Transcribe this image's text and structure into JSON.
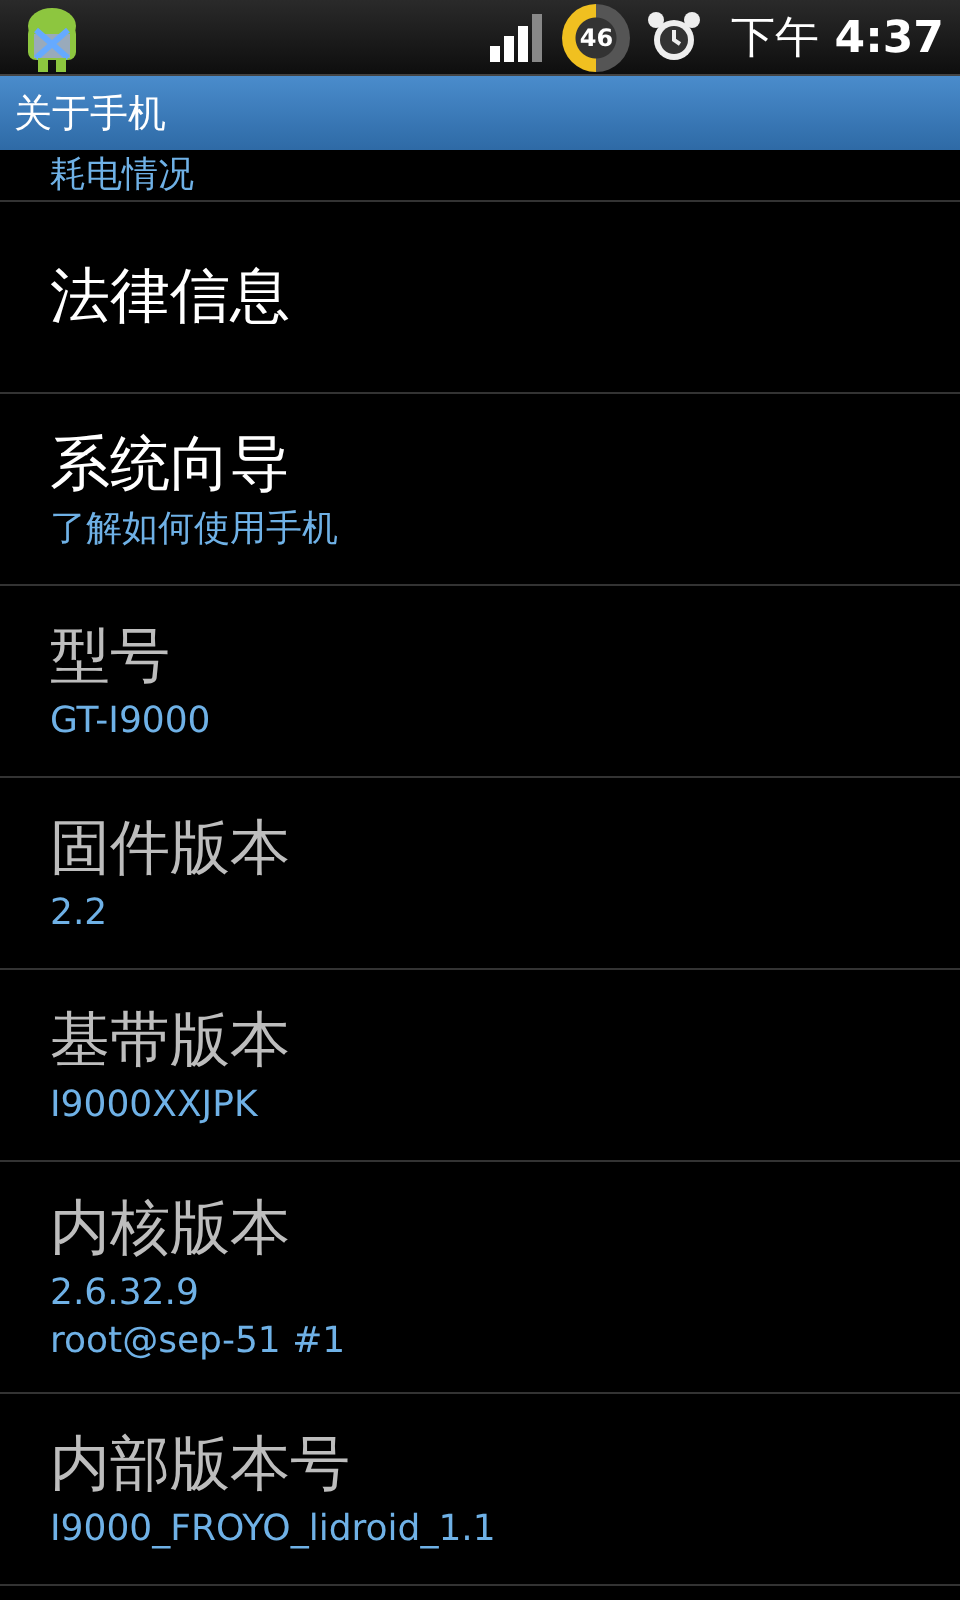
{
  "status_bar": {
    "period": "下午",
    "time": "4:37",
    "battery": "46"
  },
  "title": "关于手机",
  "partial_item": {
    "summary": "耗电情况"
  },
  "items": [
    {
      "title": "法律信息",
      "disabled": false
    },
    {
      "title": "系统向导",
      "summary": [
        "了解如何使用手机"
      ],
      "disabled": false
    },
    {
      "title": "型号",
      "summary": [
        "GT-I9000"
      ],
      "disabled": true
    },
    {
      "title": "固件版本",
      "summary": [
        "2.2"
      ],
      "disabled": true
    },
    {
      "title": "基带版本",
      "summary": [
        "I9000XXJPK"
      ],
      "disabled": true
    },
    {
      "title": "内核版本",
      "summary": [
        "2.6.32.9",
        "root@sep-51 #1"
      ],
      "disabled": true
    },
    {
      "title": "内部版本号",
      "summary": [
        "I9000_FROYO_lidroid_1.1"
      ],
      "disabled": true
    }
  ]
}
